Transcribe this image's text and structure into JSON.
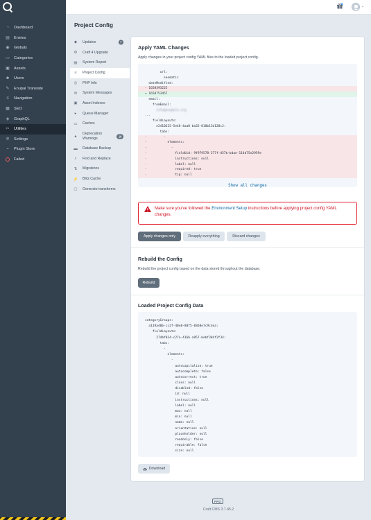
{
  "sidebar": {
    "items": [
      {
        "label": "Dashboard",
        "icon": "gauge-icon",
        "glyph": "◔"
      },
      {
        "label": "Entries",
        "icon": "document-icon",
        "glyph": "▤"
      },
      {
        "label": "Globals",
        "icon": "globe-icon",
        "glyph": "◉"
      },
      {
        "label": "Categories",
        "icon": "folder-icon",
        "glyph": "▭"
      },
      {
        "label": "Assets",
        "icon": "image-icon",
        "glyph": "▣"
      },
      {
        "label": "Users",
        "icon": "users-icon",
        "glyph": "☻"
      },
      {
        "label": "Enupal Translate",
        "icon": "translate-icon",
        "glyph": "✎"
      },
      {
        "label": "Navigation",
        "icon": "navigation-icon",
        "glyph": "≡"
      },
      {
        "label": "SEO",
        "icon": "seo-icon",
        "glyph": "▦"
      },
      {
        "label": "GraphQL",
        "icon": "graphql-icon",
        "glyph": "◈"
      },
      {
        "label": "Utilities",
        "icon": "wrench-icon",
        "glyph": "✂"
      },
      {
        "label": "Settings",
        "icon": "gear-icon",
        "glyph": "✲"
      },
      {
        "label": "Plugin Store",
        "icon": "plug-icon",
        "glyph": "⌁"
      },
      {
        "label": "Failed",
        "icon": "failed-icon",
        "glyph": ""
      }
    ],
    "active_index": 10
  },
  "page_title": "Project Config",
  "submenu": [
    {
      "label": "Updates",
      "glyph": "◆",
      "badge": "7"
    },
    {
      "label": "Craft 4 Upgrade",
      "glyph": "⚙"
    },
    {
      "label": "System Report",
      "glyph": "▤"
    },
    {
      "label": "Project Config",
      "glyph": "≡"
    },
    {
      "label": "PHP Info",
      "glyph": "◎"
    },
    {
      "label": "System Messages",
      "glyph": "✉"
    },
    {
      "label": "Asset Indexes",
      "glyph": "▣"
    },
    {
      "label": "Queue Manager",
      "glyph": "▸"
    },
    {
      "label": "Caches",
      "glyph": "▭"
    },
    {
      "label": "Deprecation Warnings",
      "glyph": "▲",
      "badge": "16"
    },
    {
      "label": "Database Backup",
      "glyph": "▬"
    },
    {
      "label": "Find and Replace",
      "glyph": "⌕"
    },
    {
      "label": "Migrations",
      "glyph": "⇅"
    },
    {
      "label": "Blitz Cache",
      "glyph": "⚡"
    },
    {
      "label": "Generate transforms",
      "glyph": "▢"
    }
  ],
  "apply": {
    "title": "Apply YAML Changes",
    "description": "Apply changes in your project config YAML files to the loaded project config.",
    "diff_lines": [
      {
        "type": "ctx",
        "text": "        url:"
      },
      {
        "type": "ctx",
        "text": "          seomatic"
      },
      {
        "type": "ctx",
        "text": "  dateModified:"
      },
      {
        "type": "del",
        "text": "  1658393225"
      },
      {
        "type": "add",
        "text": "  1658753457"
      },
      {
        "type": "ctx",
        "text": "  email:"
      },
      {
        "type": "ctx",
        "text": "    fromEmail:"
      },
      {
        "type": "blur",
        "text": "      info@example.org"
      },
      {
        "type": "ctx",
        "text": "..."
      },
      {
        "type": "ctx",
        "text": "    fieldLayouts:"
      },
      {
        "type": "ctx",
        "text": "      e2410225-5e46-4aa8-ba32-018b13d128c2:"
      },
      {
        "type": "ctx",
        "text": "        tabs:"
      },
      {
        "type": "del",
        "text": "          -"
      },
      {
        "type": "del",
        "text": "            elements:"
      },
      {
        "type": "del",
        "text": "              -"
      },
      {
        "type": "del",
        "text": "                fieldUid: 9f979578-277f-457b-bdae-114d75e2959e"
      },
      {
        "type": "del",
        "text": "                instructions: null"
      },
      {
        "type": "del",
        "text": "                label: null"
      },
      {
        "type": "del",
        "text": "                required: true"
      },
      {
        "type": "del",
        "text": "                tip: null"
      }
    ],
    "show_all": "Show all changes",
    "warning_pre": "Make sure you've followed the ",
    "warning_link": "Environment Setup",
    "warning_post": " instructions before applying project config YAML changes.",
    "buttons": [
      "Apply changes only",
      "Reapply everything",
      "Discard changes"
    ]
  },
  "rebuild": {
    "title": "Rebuild the Config",
    "description": "Rebuild the project config based on the data stored throughout the database.",
    "button": "Rebuild"
  },
  "loaded": {
    "title": "Loaded Project Config Data",
    "lines": [
      "categoryGroups:",
      "  a119a40b-cc2f-40e8-8875-8368e7c9c3ea:",
      "    fieldLayouts:",
      "      274bf034-c27a-416b-a957-bebf384f2f34:",
      "        tabs:",
      "          -",
      "            elements:",
      "              -",
      "                autocapitalize: true",
      "                autocomplete: false",
      "                autocorrect: true",
      "                class: null",
      "                disabled: false",
      "                id: null",
      "                instructions: null",
      "                label: null",
      "                max: null",
      "                min: null",
      "                name: null",
      "                orientation: null",
      "                placeholder: null",
      "                readonly: false",
      "                requirable: false",
      "                size: null"
    ],
    "download": "Download"
  },
  "footer": {
    "edition": "PRO",
    "version": "Craft CMS 3.7.45.2"
  }
}
